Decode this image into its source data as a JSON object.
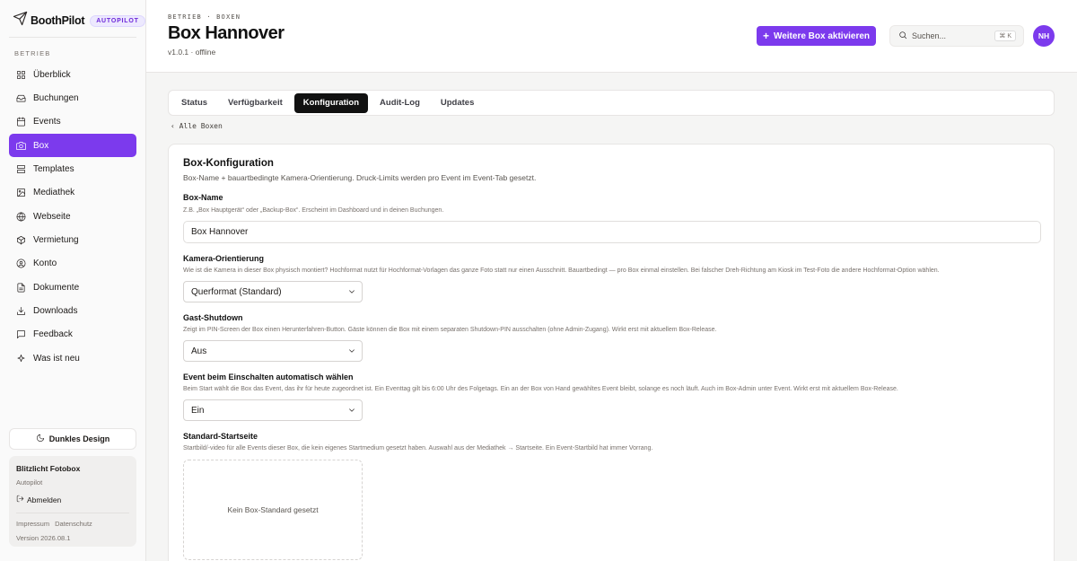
{
  "brand": {
    "name": "BoothPilot",
    "badge": "AUTOPILOT"
  },
  "sidebar": {
    "section": "BETRIEB",
    "items": [
      {
        "label": "Überblick",
        "icon": "grid-icon"
      },
      {
        "label": "Buchungen",
        "icon": "inbox-icon"
      },
      {
        "label": "Events",
        "icon": "calendar-icon"
      },
      {
        "label": "Box",
        "icon": "camera-icon",
        "active": true
      },
      {
        "label": "Templates",
        "icon": "layout-icon"
      },
      {
        "label": "Mediathek",
        "icon": "image-icon"
      },
      {
        "label": "Webseite",
        "icon": "globe-icon"
      },
      {
        "label": "Vermietung",
        "icon": "package-icon"
      },
      {
        "label": "Konto",
        "icon": "user-circle-icon"
      },
      {
        "label": "Dokumente",
        "icon": "file-icon"
      },
      {
        "label": "Downloads",
        "icon": "download-icon"
      },
      {
        "label": "Feedback",
        "icon": "message-icon"
      },
      {
        "label": "Was ist neu",
        "icon": "sparkle-icon"
      }
    ],
    "dark_mode_label": "Dunkles Design",
    "account": {
      "name": "Blitzlicht Fotobox",
      "plan": "Autopilot",
      "logout": "Abmelden",
      "links": [
        "Impressum",
        "Datenschutz"
      ],
      "version": "Version 2026.08.1"
    }
  },
  "header": {
    "breadcrumb": "BETRIEB · BOXEN",
    "title": "Box Hannover",
    "subtitle": "v1.0.1 · offline",
    "primary_button": "Weitere Box aktivieren",
    "search_placeholder": "Suchen...",
    "search_shortcut": "⌘ K",
    "avatar_initials": "NH"
  },
  "tabs": [
    {
      "label": "Status"
    },
    {
      "label": "Verfügbarkeit"
    },
    {
      "label": "Konfiguration",
      "active": true
    },
    {
      "label": "Audit-Log"
    },
    {
      "label": "Updates"
    }
  ],
  "back_link": "‹ Alle Boxen",
  "card": {
    "title": "Box-Konfiguration",
    "description": "Box-Name + bauartbedingte Kamera-Orientierung. Druck-Limits werden pro Event im Event-Tab gesetzt.",
    "fields": {
      "box_name": {
        "label": "Box-Name",
        "help": "Z.B. „Box Hauptgerät“ oder „Backup-Box“. Erscheint im Dashboard und in deinen Buchungen.",
        "value": "Box Hannover"
      },
      "orientation": {
        "label": "Kamera-Orientierung",
        "help": "Wie ist die Kamera in dieser Box physisch montiert? Hochformat nutzt für Hochformat-Vorlagen das ganze Foto statt nur einen Ausschnitt. Bauartbedingt — pro Box einmal einstellen. Bei falscher Dreh-Richtung am Kiosk im Test-Foto die andere Hochformat-Option wählen.",
        "value": "Querformat (Standard)"
      },
      "shutdown": {
        "label": "Gast-Shutdown",
        "help": "Zeigt im PIN-Screen der Box einen Herunterfahren-Button. Gäste können die Box mit einem separaten Shutdown-PIN ausschalten (ohne Admin-Zugang). Wirkt erst mit aktuellem Box-Release.",
        "value": "Aus"
      },
      "auto_event": {
        "label": "Event beim Einschalten automatisch wählen",
        "help": "Beim Start wählt die Box das Event, das ihr für heute zugeordnet ist. Ein Eventtag gilt bis 6:00 Uhr des Folgetags. Ein an der Box von Hand gewähltes Event bleibt, solange es noch läuft. Auch im Box-Admin unter Event. Wirkt erst mit aktuellem Box-Release.",
        "value": "Ein"
      },
      "start_page": {
        "label": "Standard-Startseite",
        "help": "Startbild/-video für alle Events dieser Box, die kein eigenes Startmedium gesetzt haben. Auswahl aus der Mediathek → Startseite. Ein Event-Startbild hat immer Vorrang.",
        "empty": "Kein Box-Standard gesetzt"
      }
    }
  },
  "colors": {
    "accent": "#7c3aed",
    "tab_active": "#111111"
  }
}
